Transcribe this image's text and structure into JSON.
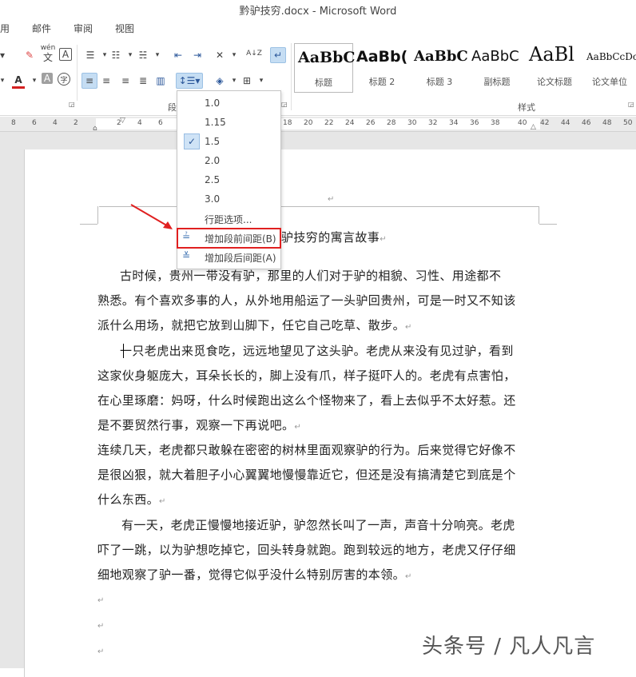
{
  "window": {
    "title": "黔驴技穷.docx - Microsoft Word"
  },
  "tabs": [
    "用",
    "邮件",
    "审阅",
    "视图"
  ],
  "ribbon": {
    "group_paragraph_label": "段",
    "group_styles_label": "样式",
    "wen_glyph": "wén",
    "wen_char": "文",
    "char_border_glyph": "A",
    "highlight_glyph": "A",
    "font_color_glyph": "A",
    "shade_glyph": "A",
    "encircle_glyph": "字",
    "sort_glyph": "A↓Z",
    "styles": [
      {
        "preview": "AaBbC",
        "name": "标题"
      },
      {
        "preview": "AaBb(",
        "name": "标题 2"
      },
      {
        "preview": "AaBbC",
        "name": "标题 3"
      },
      {
        "preview": "AaBbC",
        "name": "副标题"
      },
      {
        "preview": "AaBl",
        "name": "论文标题"
      },
      {
        "preview": "AaBbCcDc",
        "name": "论文单位"
      }
    ],
    "colors": {
      "font_color": "#d42020",
      "accent": "#2b579a"
    }
  },
  "ruler": {
    "left_numbers": [
      "8",
      "6",
      "4",
      "2"
    ],
    "mid_numbers": [
      "2",
      "4",
      "6"
    ],
    "right_numbers": [
      "18",
      "20",
      "22",
      "24",
      "26",
      "28",
      "30",
      "32",
      "34",
      "36",
      "38",
      "40",
      "42",
      "44",
      "46",
      "48",
      "50"
    ]
  },
  "line_spacing_menu": {
    "options": [
      "1.0",
      "1.15",
      "1.5",
      "2.0",
      "2.5",
      "3.0"
    ],
    "selected": "1.5",
    "line_options": "行距选项...",
    "add_before": "增加段前间距(B)",
    "add_after": "增加段后间距(A)"
  },
  "document": {
    "title_tail": "驴技穷的寓言故事",
    "paragraphs": [
      [
        "古时候，贵州一带没有驴，那里的人们对于驴的相貌、习性、用途都不",
        "熟悉。有个喜欢多事的人，从外地用船运了一头驴回贵州，可是一时又不知该",
        "派什么用场，就把它放到山脚下，任它自己吃草、散步。"
      ],
      [
        "一只老虎出来觅食吃，远远地望见了这头驴。老虎从来没有见过驴，看到",
        "这家伙身躯庞大，耳朵长长的，脚上没有爪，样子挺吓人的。老虎有点害怕，",
        "在心里琢磨：妈呀，什么时候跑出这么个怪物来了，看上去似乎不太好惹。还",
        "是不要贸然行事，观察一下再说吧。"
      ],
      [
        "连续几天，老虎都只敢躲在密密的树林里面观察驴的行为。后来觉得它好像不",
        "是很凶狠，就大着胆子小心翼翼地慢慢靠近它，但还是没有搞清楚它到底是个",
        "什么东西。"
      ],
      [
        "有一天，老虎正慢慢地接近驴，驴忽然长叫了一声，声音十分响亮。老虎",
        "吓了一跳，以为驴想吃掉它，回头转身就跑。跑到较远的地方，老虎又仔仔细",
        "细地观察了驴一番，觉得它似乎没什么特别厉害的本领。"
      ]
    ]
  },
  "watermark": "头条号 / 凡人凡言"
}
